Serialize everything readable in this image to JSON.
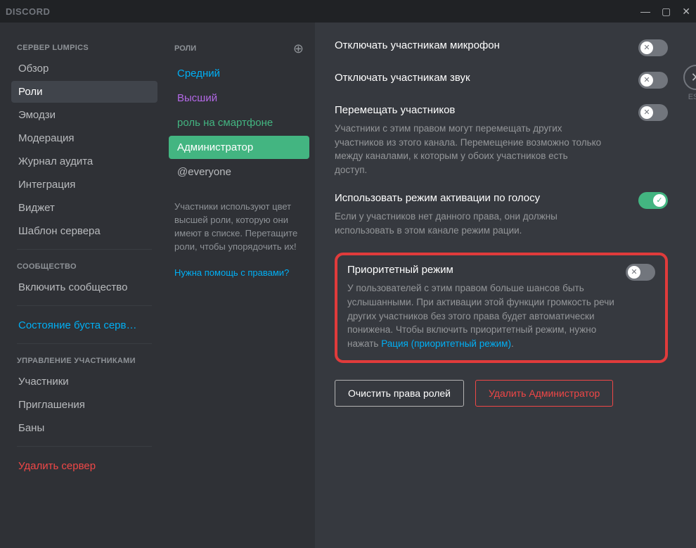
{
  "app_name": "DISCORD",
  "esc_label": "ESC",
  "sidebar": {
    "server_header": "СЕРВЕР LUMPICS",
    "items_server": [
      {
        "label": "Обзор"
      },
      {
        "label": "Роли"
      },
      {
        "label": "Эмодзи"
      },
      {
        "label": "Модерация"
      },
      {
        "label": "Журнал аудита"
      },
      {
        "label": "Интеграция"
      },
      {
        "label": "Виджет"
      },
      {
        "label": "Шаблон сервера"
      }
    ],
    "community_header": "СООБЩЕСТВО",
    "community_label": "Включить сообщество",
    "boost_label": "Состояние буста серв…",
    "members_header": "УПРАВЛЕНИЕ УЧАСТНИКАМИ",
    "items_members": [
      {
        "label": "Участники"
      },
      {
        "label": "Приглашения"
      },
      {
        "label": "Баны"
      }
    ],
    "delete_server": "Удалить сервер"
  },
  "roles": {
    "header": "РОЛИ",
    "items": [
      {
        "label": "Средний",
        "color": "#00aff4"
      },
      {
        "label": "Высший",
        "color": "#b368e6"
      },
      {
        "label": "роль на смартфоне",
        "color": "#43b581"
      },
      {
        "label": "Администратор",
        "color": "#ffffff"
      },
      {
        "label": "@everyone",
        "color": "#b9bbbe"
      }
    ],
    "hint": "Участники используют цвет высшей роли, которую они имеют в списке. Перетащите роли, чтобы упорядочить их!",
    "help": "Нужна помощь с правами?"
  },
  "permissions": {
    "mute": {
      "title": "Отключать участникам микрофон"
    },
    "deafen": {
      "title": "Отключать участникам звук"
    },
    "move": {
      "title": "Перемещать участников",
      "desc": "Участники с этим правом могут перемещать других участников из этого канала. Перемещение возможно только между каналами, к которым у обоих участников есть доступ."
    },
    "voice_activity": {
      "title": "Использовать режим активации по голосу",
      "desc": "Если у участников нет данного права, они должны использовать в этом канале режим рации."
    },
    "priority": {
      "title": "Приоритетный режим",
      "desc_pre": "У пользователей с этим правом больше шансов быть услышанными. При активации этой функции громкость речи других участников без этого права будет автоматически понижена. Чтобы включить приоритетный режим, нужно нажать ",
      "link": "Рация (приоритетный режим)",
      "desc_post": "."
    }
  },
  "buttons": {
    "clear": "Очистить права ролей",
    "delete": "Удалить Администратор"
  }
}
